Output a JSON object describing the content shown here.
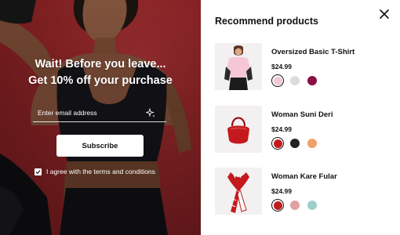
{
  "hero": {
    "headline_line1": "Wait! Before you leave...",
    "headline_line2": "Get 10% off your purchase",
    "email_placeholder": "Enter email address",
    "subscribe_label": "Subscribe",
    "terms_label": "I agree with the terms and conditions",
    "terms_checked": true,
    "colors": {
      "background": "#8d2426",
      "text": "#ffffff"
    }
  },
  "panel": {
    "title": "Recommend products",
    "close_icon": "close-icon",
    "products": [
      {
        "name": "Oversized Basic T-Shirt",
        "price": "$24.99",
        "thumb": "pink-tshirt-model",
        "swatches": [
          {
            "color": "#f3c7d8",
            "selected": true
          },
          {
            "color": "#dcdcdc",
            "selected": false
          },
          {
            "color": "#8a0f42",
            "selected": false
          }
        ]
      },
      {
        "name": "Woman Suni Deri",
        "price": "$24.99",
        "thumb": "red-handbag",
        "swatches": [
          {
            "color": "#c41a1e",
            "selected": true
          },
          {
            "color": "#222222",
            "selected": false
          },
          {
            "color": "#f0a06a",
            "selected": false
          }
        ]
      },
      {
        "name": "Woman Kare Fular",
        "price": "$24.99",
        "thumb": "red-white-scarf",
        "swatches": [
          {
            "color": "#c41a1e",
            "selected": true
          },
          {
            "color": "#e0a1a1",
            "selected": false
          },
          {
            "color": "#9fcfcb",
            "selected": false
          }
        ]
      }
    ]
  }
}
